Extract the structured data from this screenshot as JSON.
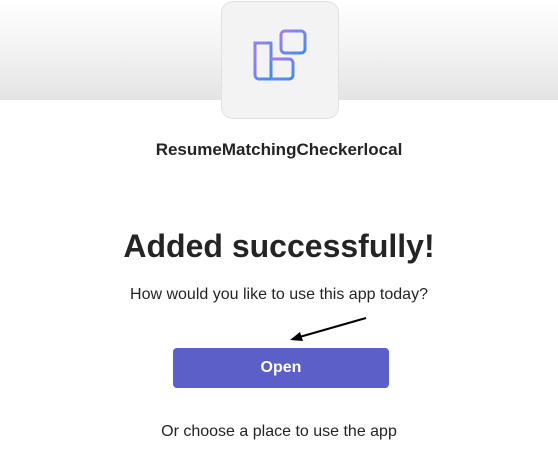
{
  "app": {
    "icon": "apps-grid-icon",
    "name": "ResumeMatchingCheckerlocal"
  },
  "dialog": {
    "headline": "Added successfully!",
    "prompt": "How would you like to use this app today?",
    "open_label": "Open",
    "choose_place_text": "Or choose a place to use the app"
  },
  "colors": {
    "primary_button": "#5b5fc7",
    "icon_gradient_start": "#a77ee8",
    "icon_gradient_end": "#3f8ee8",
    "text": "#242424"
  }
}
